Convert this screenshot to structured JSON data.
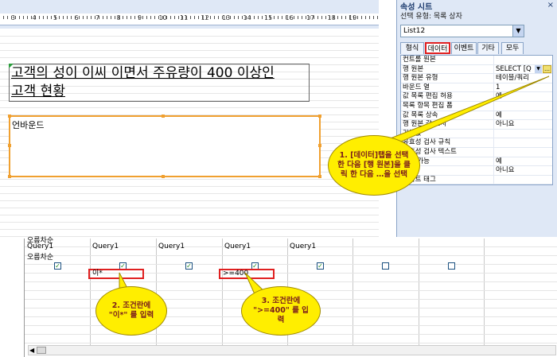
{
  "property_sheet": {
    "title": "속성 시트",
    "close": "×",
    "selection_type": "선택 유형: 목록 상자",
    "selected_object": "List12",
    "tabs": [
      "형식",
      "데이터",
      "이벤트",
      "기타",
      "모두"
    ],
    "active_tab": "데이터",
    "rows": [
      {
        "k": "컨트롤 원본",
        "v": ""
      },
      {
        "k": "행 원본",
        "v": "SELECT [Q"
      },
      {
        "k": "행 원본 유형",
        "v": "테이블/쿼리"
      },
      {
        "k": "바운드 열",
        "v": "1"
      },
      {
        "k": "값 목록 편집 허용",
        "v": "예"
      },
      {
        "k": "목록 항목 편집 폼",
        "v": ""
      },
      {
        "k": "값 목록 상속",
        "v": "예"
      },
      {
        "k": "행 원본 값 표시",
        "v": "아니요"
      },
      {
        "k": "기본값",
        "v": ""
      },
      {
        "k": "유효성 검사 규칙",
        "v": ""
      },
      {
        "k": "유효성 검사 텍스트",
        "v": ""
      },
      {
        "k": "사용 가능",
        "v": "예"
      },
      {
        "k": "잠금",
        "v": "아니요"
      },
      {
        "k": "스마트 태그",
        "v": ""
      }
    ],
    "builder_button": "…"
  },
  "ruler": {
    "numbers": [
      "3",
      "4",
      "5",
      "6",
      "7",
      "8",
      "9",
      "10",
      "11",
      "12",
      "13",
      "14",
      "15",
      "16",
      "17",
      "18",
      "19"
    ]
  },
  "form": {
    "title_line1": "고객의 성이 이씨 이면서 주유량이 400 이상인",
    "title_line2": "고객 현황",
    "listbox_label": "언바운드"
  },
  "query_grid": {
    "header_partial": "오름차순",
    "tables": [
      "Query1",
      "Query1",
      "Query1",
      "Query1",
      "Query1"
    ],
    "sort_label": "오름차순",
    "criteria": [
      "이*",
      ">=400"
    ]
  },
  "callouts": [
    {
      "id": "1",
      "text": "1. [데이터]탭을 선택한 다음 [행 원본]을 클릭 한 다음 …을 선택"
    },
    {
      "id": "2",
      "text": "2. 조건란에 \"이*\" 를 입력"
    },
    {
      "id": "3",
      "text": "3. 조건란에 \">=400\" 를 입력"
    }
  ],
  "colors": {
    "callout": "#ffee00",
    "highlight": "#e02020",
    "selection": "#f0a030"
  }
}
